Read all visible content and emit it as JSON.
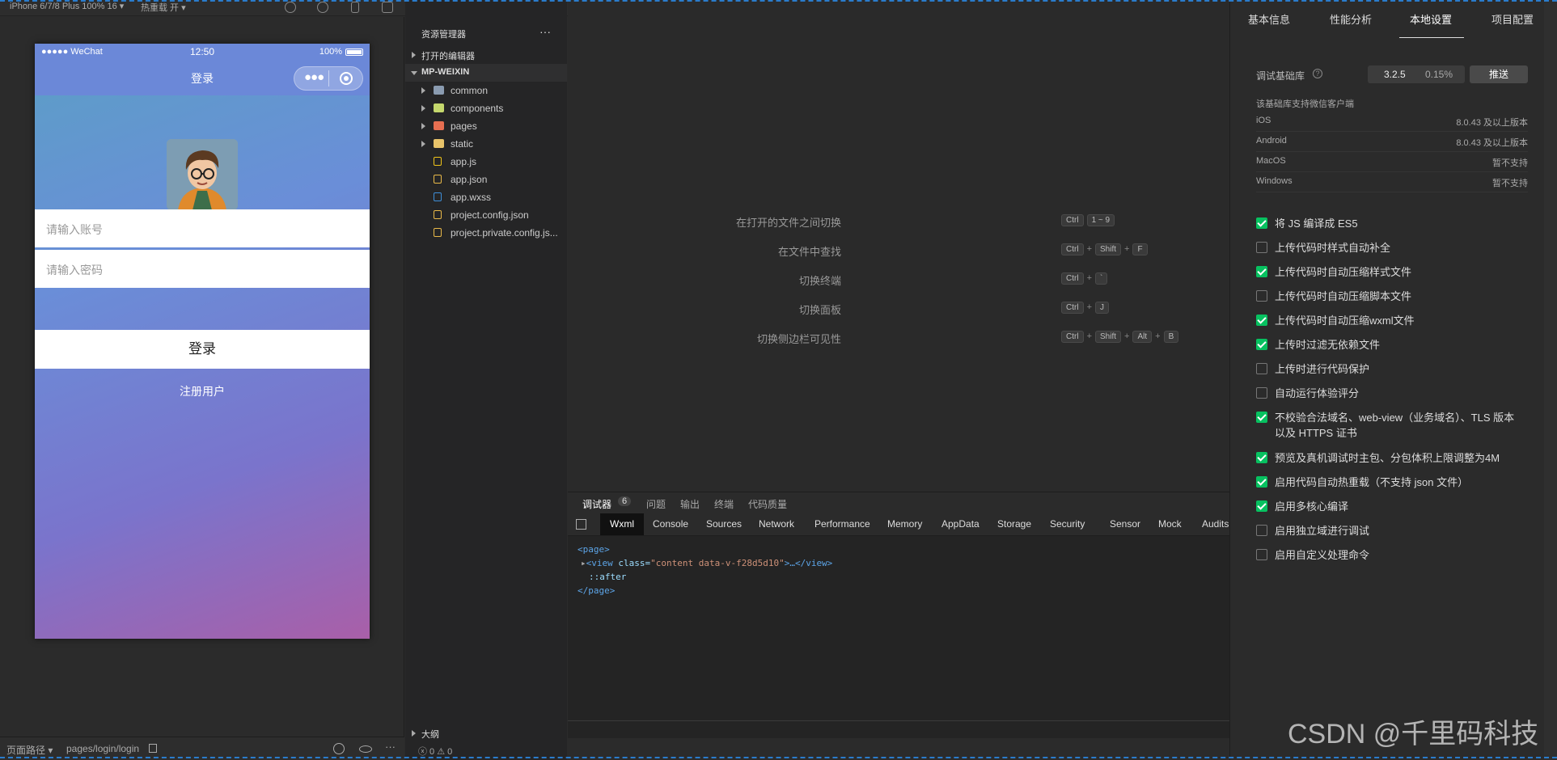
{
  "topbar": {
    "device": "iPhone 6/7/8 Plus 100% 16 ▾",
    "hotreload": "热重载 开 ▾"
  },
  "phone": {
    "carrier": "●●●●● WeChat",
    "time": "12:50",
    "battery": "100%",
    "title": "登录",
    "account_placeholder": "请输入账号",
    "password_placeholder": "请输入密码",
    "login_button": "登录",
    "register_link": "注册用户"
  },
  "sim_footer": {
    "page_path_label": "页面路径 ▾",
    "page_path": "pages/login/login"
  },
  "explorer": {
    "title": "资源管理器",
    "more": "···",
    "open_editors": "打开的编辑器",
    "project": "MP-WEIXIN",
    "items": [
      {
        "name": "common",
        "kind": "folder",
        "color": "#8a9bb0"
      },
      {
        "name": "components",
        "kind": "folder",
        "color": "#c5d86d"
      },
      {
        "name": "pages",
        "kind": "folder",
        "color": "#e76f51"
      },
      {
        "name": "static",
        "kind": "folder",
        "color": "#e9c46a"
      },
      {
        "name": "app.js",
        "kind": "file",
        "color": "#f0c419"
      },
      {
        "name": "app.json",
        "kind": "file",
        "color": "#e9b949"
      },
      {
        "name": "app.wxss",
        "kind": "file",
        "color": "#3f8fd8"
      },
      {
        "name": "project.config.json",
        "kind": "file",
        "color": "#e9b949"
      },
      {
        "name": "project.private.config.js...",
        "kind": "file",
        "color": "#e9b949"
      }
    ],
    "outline": "大纲",
    "status": "ⓧ 0 ⚠ 0"
  },
  "shortcuts": [
    {
      "label": "在打开的文件之间切换",
      "keys": [
        "Ctrl",
        "1 ~ 9"
      ],
      "joined": false
    },
    {
      "label": "在文件中查找",
      "keys": [
        "Ctrl",
        "Shift",
        "F"
      ],
      "joined": true
    },
    {
      "label": "切换终端",
      "keys": [
        "Ctrl",
        "`"
      ],
      "joined": true
    },
    {
      "label": "切换面板",
      "keys": [
        "Ctrl",
        "J"
      ],
      "joined": true
    },
    {
      "label": "切换侧边栏可见性",
      "keys": [
        "Ctrl",
        "Shift",
        "Alt",
        "B"
      ],
      "joined": true
    }
  ],
  "debugger": {
    "tabs": [
      "调试器",
      "问题",
      "输出",
      "终端",
      "代码质量"
    ],
    "badge": "6",
    "subtabs": [
      "Wxml",
      "Console",
      "Sources",
      "Network",
      "Performance",
      "Memory",
      "AppData",
      "Storage",
      "Security",
      "Sensor",
      "Mock",
      "Audits"
    ],
    "code": {
      "page_open": "<page>",
      "view_tag_open": "<view ",
      "class_attr": "class=",
      "class_val": "\"content data-v-f28d5d10\"",
      "view_rest": ">…</view>",
      "after": "::after",
      "page_close": "</page>"
    }
  },
  "settings": {
    "tabs": [
      "基本信息",
      "性能分析",
      "本地设置",
      "项目配置"
    ],
    "active_tab": 2,
    "lib_label": "调试基础库",
    "lib_version": "3.2.5",
    "lib_percent": "0.15%",
    "push_button": "推送",
    "support_title": "该基础库支持微信客户端",
    "platforms": [
      {
        "name": "iOS",
        "value": "8.0.43 及以上版本"
      },
      {
        "name": "Android",
        "value": "8.0.43 及以上版本"
      },
      {
        "name": "MacOS",
        "value": "暂不支持"
      },
      {
        "name": "Windows",
        "value": "暂不支持"
      }
    ],
    "options": [
      {
        "label": "将 JS 编译成 ES5",
        "checked": true
      },
      {
        "label": "上传代码时样式自动补全",
        "checked": false
      },
      {
        "label": "上传代码时自动压缩样式文件",
        "checked": true
      },
      {
        "label": "上传代码时自动压缩脚本文件",
        "checked": false
      },
      {
        "label": "上传代码时自动压缩wxml文件",
        "checked": true
      },
      {
        "label": "上传时过滤无依赖文件",
        "checked": true
      },
      {
        "label": "上传时进行代码保护",
        "checked": false
      },
      {
        "label": "自动运行体验评分",
        "checked": false
      },
      {
        "label": "不校验合法域名、web-view（业务域名）、TLS 版本以及 HTTPS 证书",
        "checked": true
      },
      {
        "label": "预览及真机调试时主包、分包体积上限调整为4M",
        "checked": true
      },
      {
        "label": "启用代码自动热重载（不支持 json 文件）",
        "checked": true
      },
      {
        "label": "启用多核心编译",
        "checked": true
      },
      {
        "label": "启用独立域进行调试",
        "checked": false
      },
      {
        "label": "启用自定义处理命令",
        "checked": false
      }
    ]
  },
  "watermark": "CSDN @千里码科技"
}
